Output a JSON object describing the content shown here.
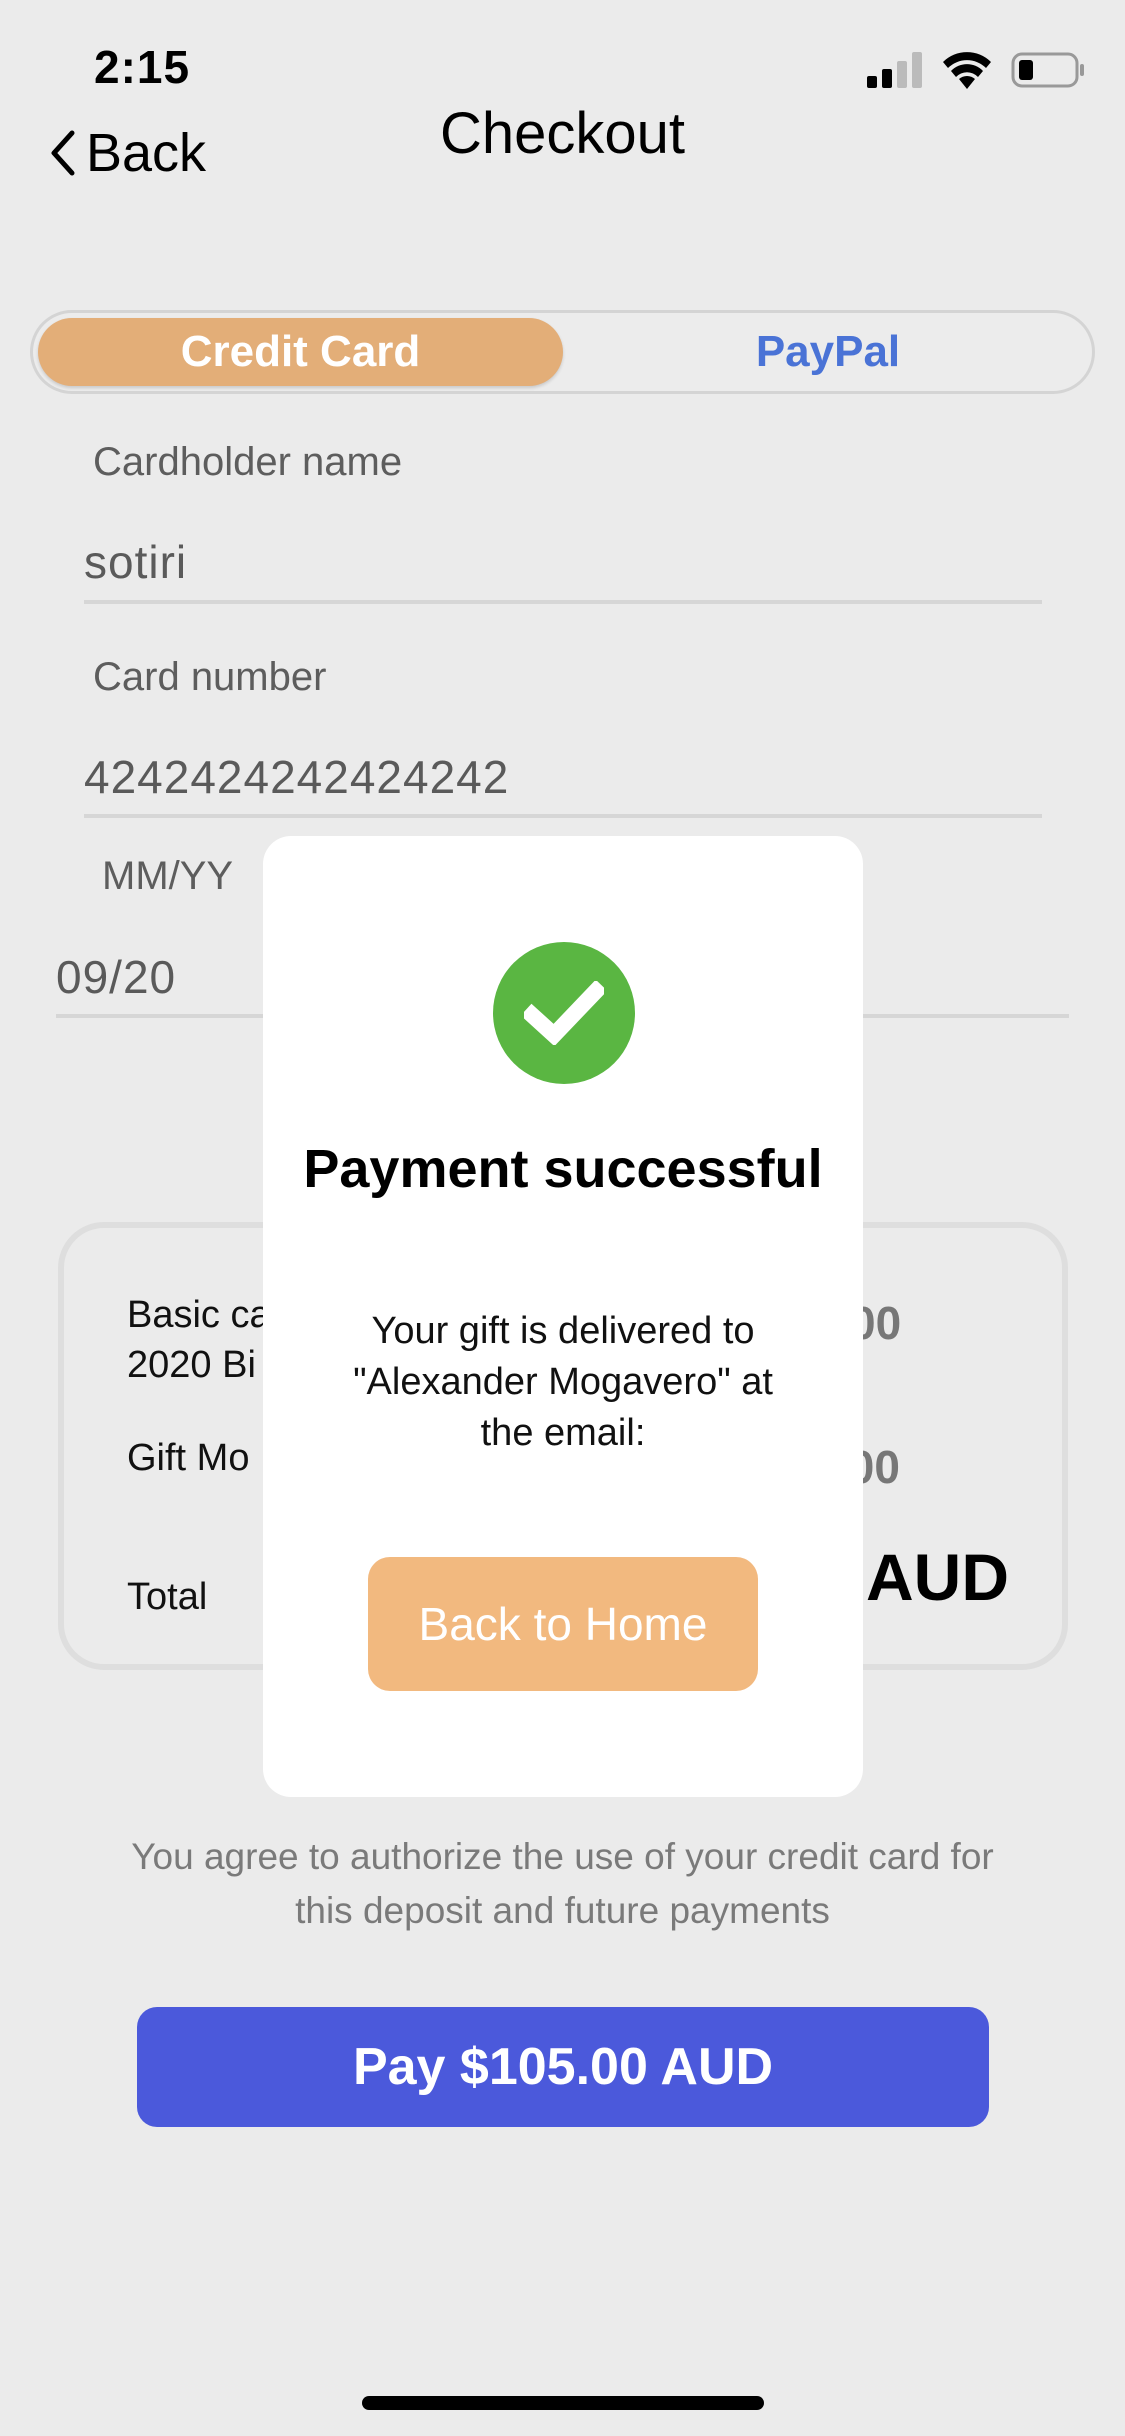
{
  "status_bar": {
    "time": "2:15"
  },
  "nav": {
    "back_label": "Back",
    "title": "Checkout"
  },
  "payment_tabs": {
    "credit_card": "Credit Card",
    "paypal": "PayPal",
    "selected": "Credit Card"
  },
  "form": {
    "cardholder_label": "Cardholder name",
    "cardholder_value": "sotiri",
    "card_number_label": "Card number",
    "card_number_value": "4242424242424242",
    "expiry_label": "MM/YY",
    "expiry_value": "09/20"
  },
  "summary": {
    "item1_line1": "Basic ca",
    "item1_line2": "2020 Bi",
    "item1_amount": "00",
    "item2_label": "Gift Mo",
    "item2_amount": ".00",
    "total_label": "Total",
    "total_amount": "AUD"
  },
  "agree_text": "You agree to authorize the use of your credit card for this deposit and future payments",
  "pay_button": "Pay $105.00 AUD",
  "modal": {
    "title": "Payment successful",
    "message": "Your gift is delivered to \"Alexander Mogavero\" at the email:",
    "button": "Back to Home"
  },
  "colors": {
    "background": "#ebebeb",
    "tab_selected": "#e3ae78",
    "paypal_text": "#4a73d6",
    "pay_button": "#4b59db",
    "success_green": "#5ab642",
    "home_button": "#f2b97f"
  }
}
